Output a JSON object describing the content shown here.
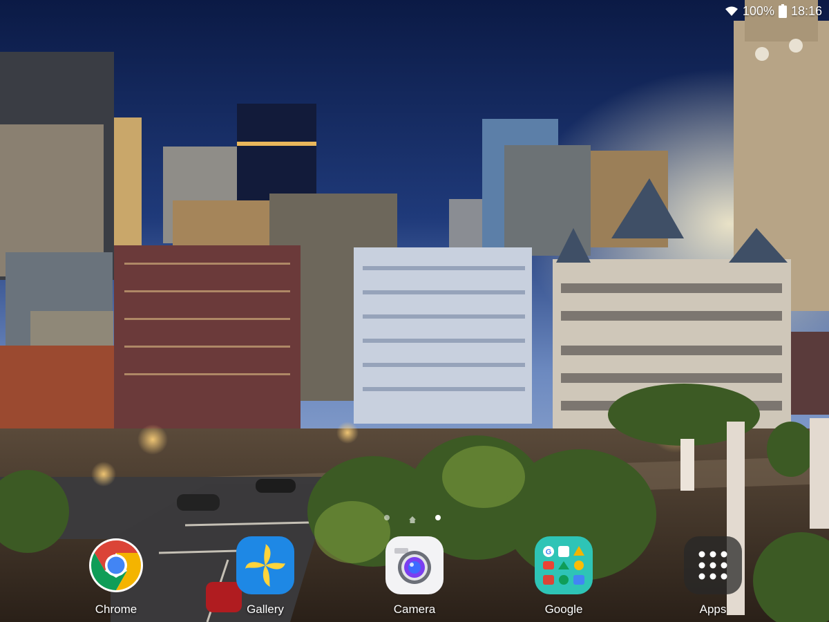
{
  "status_bar": {
    "battery_text": "100%",
    "time": "18:16",
    "icons": [
      "wifi-icon",
      "battery-icon"
    ]
  },
  "wallpaper": {
    "description_icon": "city-wallpaper",
    "sky_color_top": "#0e1c48",
    "sky_color_horizon": "#3d5c9a",
    "street_light_color": "#f6b24a"
  },
  "home_indicator": {
    "pages": 2,
    "active_page": 1
  },
  "dock": {
    "apps": [
      {
        "label": "Chrome",
        "icon": "chrome-icon"
      },
      {
        "label": "Gallery",
        "icon": "gallery-icon"
      },
      {
        "label": "Camera",
        "icon": "camera-icon"
      },
      {
        "label": "Google",
        "icon": "google-folder-icon"
      },
      {
        "label": "Apps",
        "icon": "apps-grid-icon"
      }
    ]
  }
}
